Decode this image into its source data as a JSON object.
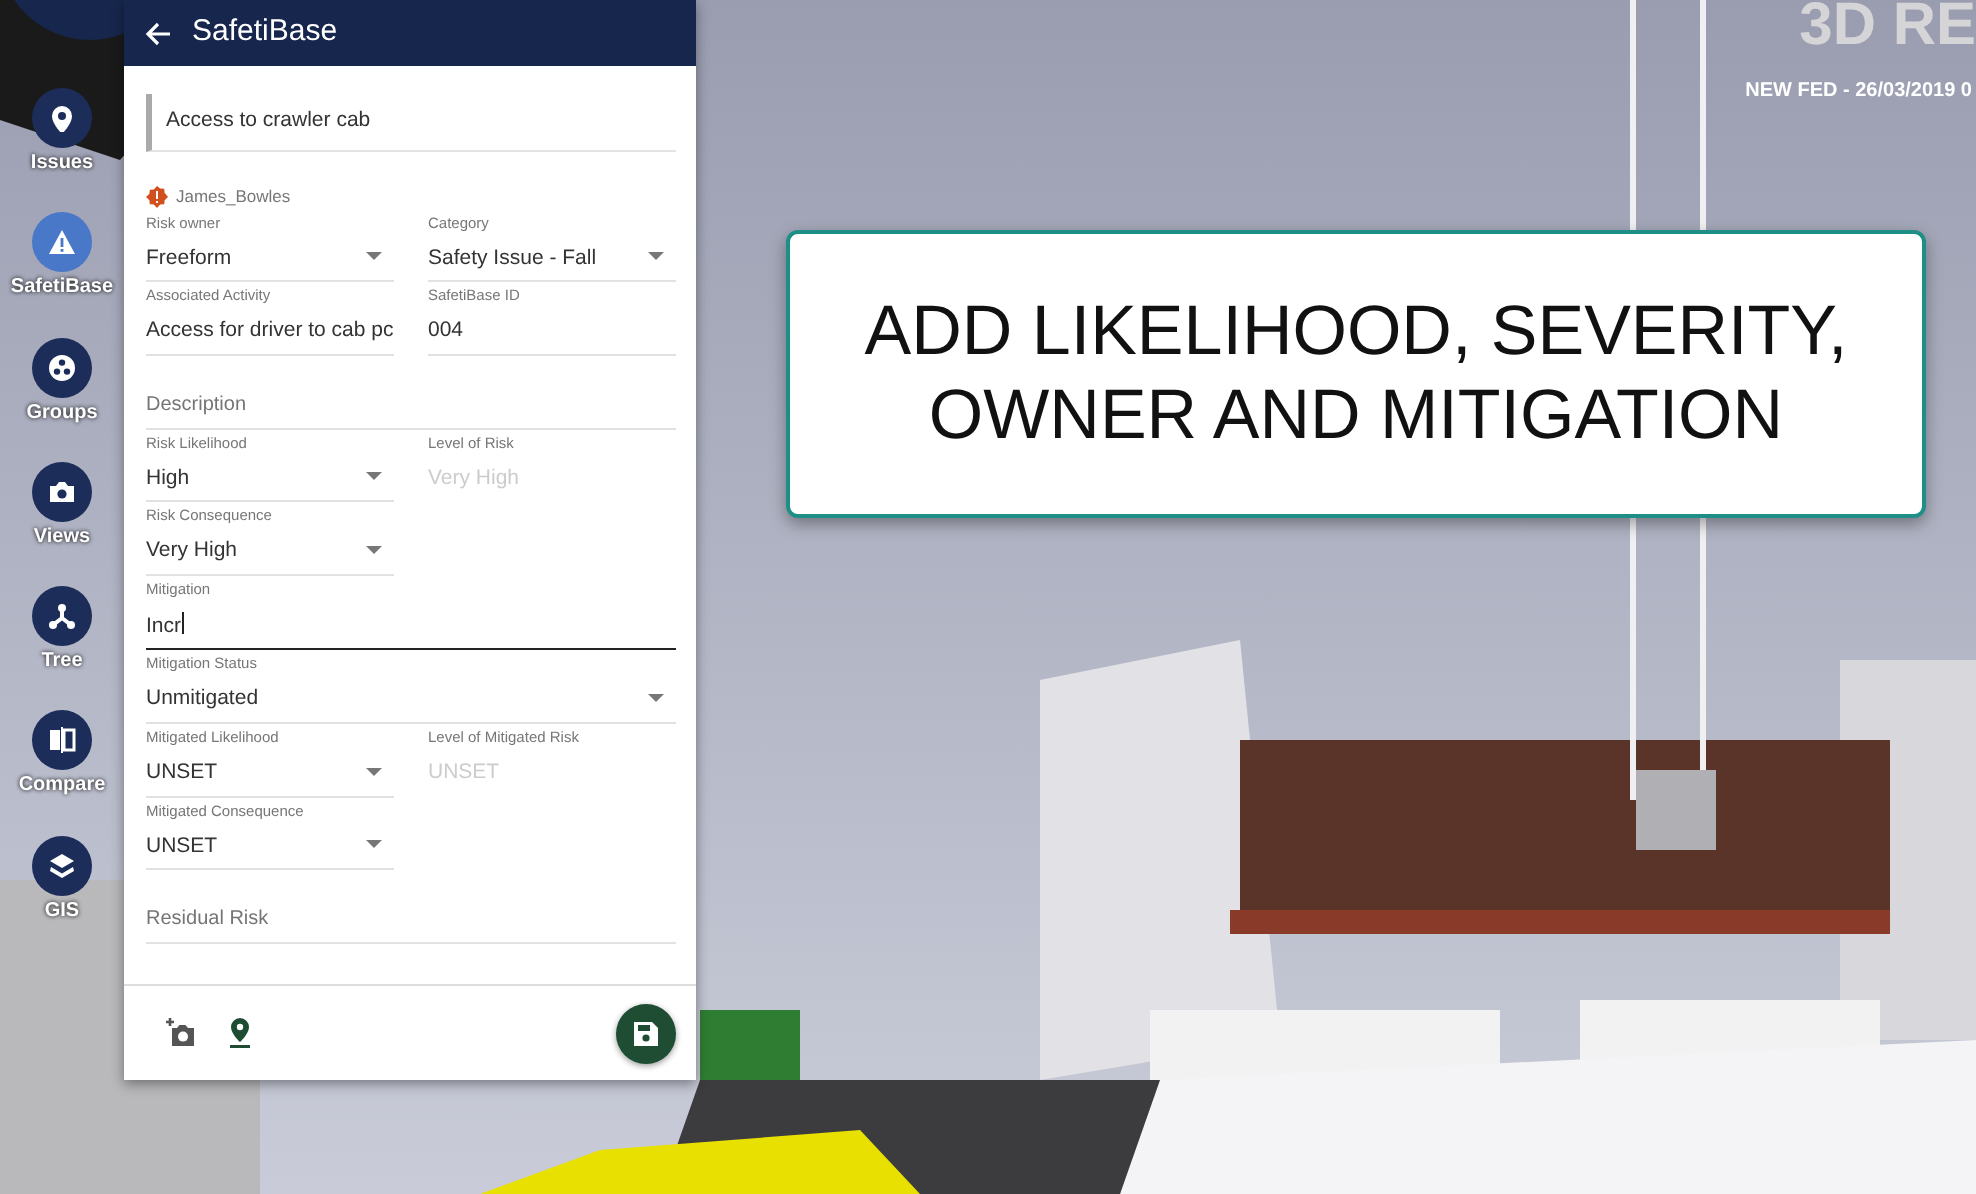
{
  "viewer": {
    "title": "3D RE",
    "revision": "NEW FED - 26/03/2019 0"
  },
  "sidebar": {
    "items": [
      {
        "label": "Issues",
        "selected": false
      },
      {
        "label": "SafetiBase",
        "selected": true
      },
      {
        "label": "Groups",
        "selected": false
      },
      {
        "label": "Views",
        "selected": false
      },
      {
        "label": "Tree",
        "selected": false
      },
      {
        "label": "Compare",
        "selected": false
      },
      {
        "label": "GIS",
        "selected": false
      }
    ]
  },
  "panel": {
    "title": "SafetiBase",
    "name": "Access to crawler cab",
    "author": "James_Bowles",
    "rows": [
      [
        {
          "kind": "select",
          "label": "Risk owner",
          "value": "Freeform"
        },
        {
          "kind": "select",
          "label": "Category",
          "value": "Safety Issue - Fall"
        }
      ],
      [
        {
          "kind": "text",
          "label": "Associated Activity",
          "value": "Access for driver to cab pc",
          "focused": false
        },
        {
          "kind": "text",
          "label": "SafetiBase ID",
          "value": "004",
          "focused": false
        }
      ],
      [
        {
          "kind": "placeholder",
          "placeholder": "Description"
        }
      ],
      [
        {
          "kind": "select",
          "label": "Risk Likelihood",
          "value": "High"
        },
        {
          "kind": "readonly",
          "label": "Level of Risk",
          "value": "Very High"
        }
      ],
      [
        {
          "kind": "select",
          "label": "Risk Consequence",
          "value": "Very High"
        }
      ],
      [
        {
          "kind": "wide-text",
          "label": "Mitigation",
          "value": "Incr",
          "focused": true
        }
      ],
      [
        {
          "kind": "wide-select",
          "label": "Mitigation Status",
          "value": "Unmitigated"
        }
      ],
      [
        {
          "kind": "select",
          "label": "Mitigated Likelihood",
          "value": "UNSET"
        },
        {
          "kind": "readonly",
          "label": "Level of Mitigated Risk",
          "value": "UNSET"
        }
      ],
      [
        {
          "kind": "select",
          "label": "Mitigated Consequence",
          "value": "UNSET"
        }
      ],
      [
        {
          "kind": "placeholder",
          "placeholder": "Residual Risk"
        }
      ]
    ]
  },
  "callout": {
    "lines": [
      "ADD LIKELIHOOD, SEVERITY,",
      "OWNER AND MITIGATION"
    ]
  }
}
